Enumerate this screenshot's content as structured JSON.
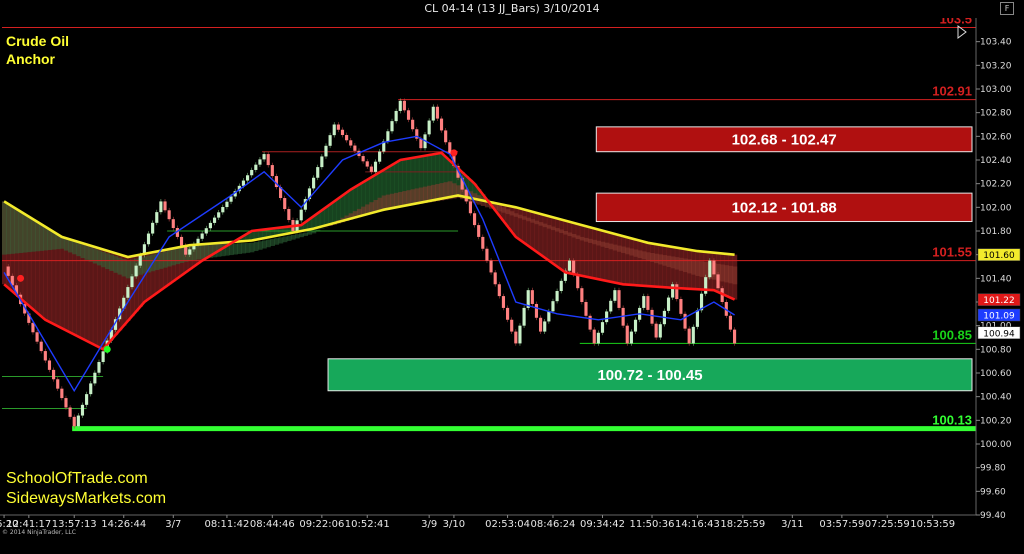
{
  "window": {
    "title": "CL 04-14 (13 JJ_Bars)  3/10/2014",
    "button_label": "F"
  },
  "branding": {
    "title_line1": "Crude Oil",
    "title_line2": "Anchor",
    "site1": "SchoolOfTrade.com",
    "site2": "SidewaysMarkets.com",
    "copyright": "© 2014 NinjaTrader, LLC"
  },
  "colors": {
    "background": "#000000",
    "up_bar": "#c8f0c8",
    "down_bar": "#ff8080",
    "fast_ma": "#1e3cff",
    "slow_ma": "#ff1a1a",
    "long_ma": "#f2ea2c",
    "resistance": "#d42020",
    "support": "#19d219",
    "bright_support": "#33ff33"
  },
  "chart_data": {
    "type": "renko_bars_with_moving_averages",
    "ylim": [
      99.4,
      103.6
    ],
    "y_ticks": [
      99.4,
      99.6,
      99.8,
      100.0,
      100.2,
      100.4,
      100.6,
      100.8,
      101.0,
      101.2,
      101.4,
      101.6,
      101.8,
      102.0,
      102.2,
      102.4,
      102.6,
      102.8,
      103.0,
      103.2,
      103.4
    ],
    "y_tick_labels": [
      "99.40",
      "99.60",
      "99.80",
      "100.00",
      "100.20",
      "100.40",
      "100.60",
      "100.80",
      "101.00",
      "101.20",
      "101.40",
      "101.60",
      "101.80",
      "102.00",
      "102.20",
      "102.40",
      "102.60",
      "102.80",
      "103.00",
      "103.20",
      "103.40"
    ],
    "x_ticks": [
      {
        "label": "46:20",
        "i": 0
      },
      {
        "label": "12:41:17",
        "i": 6
      },
      {
        "label": "13:57:13",
        "i": 17
      },
      {
        "label": "14:26:44",
        "i": 29
      },
      {
        "label": "3/7",
        "i": 41
      },
      {
        "label": "08:11:42",
        "i": 54
      },
      {
        "label": "08:44:46",
        "i": 65
      },
      {
        "label": "09:22:06",
        "i": 77
      },
      {
        "label": "10:52:41",
        "i": 88
      },
      {
        "label": "3/9",
        "i": 103
      },
      {
        "label": "3/10",
        "i": 109
      },
      {
        "label": "02:53:04",
        "i": 122
      },
      {
        "label": "08:46:24",
        "i": 133
      },
      {
        "label": "09:34:42",
        "i": 145
      },
      {
        "label": "11:50:36",
        "i": 157
      },
      {
        "label": "14:16:43",
        "i": 168
      },
      {
        "label": "18:25:59",
        "i": 179
      },
      {
        "label": "3/11",
        "i": 191
      },
      {
        "label": "03:57:59",
        "i": 203
      },
      {
        "label": "07:25:59",
        "i": 214
      },
      {
        "label": "10:53:59",
        "i": 225
      }
    ],
    "bars_pivots": [
      {
        "i": 0,
        "p": 101.5
      },
      {
        "i": 17,
        "p": 100.15
      },
      {
        "i": 38,
        "p": 102.05
      },
      {
        "i": 44,
        "p": 101.6
      },
      {
        "i": 63,
        "p": 102.45
      },
      {
        "i": 70,
        "p": 101.8
      },
      {
        "i": 80,
        "p": 102.7
      },
      {
        "i": 89,
        "p": 102.3
      },
      {
        "i": 96,
        "p": 102.9
      },
      {
        "i": 101,
        "p": 102.5
      },
      {
        "i": 104,
        "p": 102.85
      },
      {
        "i": 124,
        "p": 100.85
      },
      {
        "i": 127,
        "p": 101.3
      },
      {
        "i": 130,
        "p": 100.95
      },
      {
        "i": 137,
        "p": 101.55
      },
      {
        "i": 143,
        "p": 100.85
      },
      {
        "i": 148,
        "p": 101.3
      },
      {
        "i": 151,
        "p": 100.85
      },
      {
        "i": 155,
        "p": 101.25
      },
      {
        "i": 158,
        "p": 100.9
      },
      {
        "i": 162,
        "p": 101.35
      },
      {
        "i": 166,
        "p": 100.85
      },
      {
        "i": 171,
        "p": 101.55
      },
      {
        "i": 177,
        "p": 100.85
      }
    ],
    "bar_count": 178,
    "x_slots": 236,
    "fast_ma": [
      [
        0,
        101.45
      ],
      [
        17,
        100.45
      ],
      [
        30,
        101.2
      ],
      [
        40,
        101.75
      ],
      [
        55,
        102.1
      ],
      [
        63,
        102.3
      ],
      [
        72,
        102.0
      ],
      [
        82,
        102.4
      ],
      [
        92,
        102.55
      ],
      [
        100,
        102.6
      ],
      [
        108,
        102.45
      ],
      [
        116,
        101.9
      ],
      [
        124,
        101.2
      ],
      [
        134,
        101.1
      ],
      [
        144,
        101.05
      ],
      [
        154,
        101.1
      ],
      [
        164,
        101.05
      ],
      [
        172,
        101.2
      ],
      [
        177,
        101.09
      ]
    ],
    "slow_ma": [
      [
        0,
        101.35
      ],
      [
        10,
        101.05
      ],
      [
        24,
        100.8
      ],
      [
        34,
        101.2
      ],
      [
        48,
        101.55
      ],
      [
        60,
        101.8
      ],
      [
        72,
        101.85
      ],
      [
        84,
        102.15
      ],
      [
        96,
        102.4
      ],
      [
        106,
        102.46
      ],
      [
        114,
        102.2
      ],
      [
        124,
        101.75
      ],
      [
        136,
        101.45
      ],
      [
        150,
        101.35
      ],
      [
        162,
        101.32
      ],
      [
        172,
        101.3
      ],
      [
        177,
        101.22
      ]
    ],
    "long_ma": [
      [
        0,
        102.05
      ],
      [
        14,
        101.75
      ],
      [
        30,
        101.58
      ],
      [
        45,
        101.68
      ],
      [
        60,
        101.72
      ],
      [
        75,
        101.82
      ],
      [
        92,
        101.98
      ],
      [
        110,
        102.1
      ],
      [
        124,
        102.0
      ],
      [
        140,
        101.85
      ],
      [
        156,
        101.7
      ],
      [
        168,
        101.63
      ],
      [
        177,
        101.6
      ]
    ],
    "cloud_upper": [
      [
        0,
        101.6
      ],
      [
        14,
        101.65
      ],
      [
        30,
        101.4
      ],
      [
        45,
        101.55
      ],
      [
        60,
        101.62
      ],
      [
        75,
        101.78
      ],
      [
        92,
        102.1
      ],
      [
        108,
        102.22
      ],
      [
        124,
        101.95
      ],
      [
        140,
        101.75
      ],
      [
        156,
        101.62
      ],
      [
        168,
        101.55
      ],
      [
        177,
        101.5
      ]
    ],
    "cloud_lower": [
      [
        0,
        102.05
      ],
      [
        14,
        101.75
      ],
      [
        30,
        101.55
      ],
      [
        45,
        101.68
      ],
      [
        60,
        101.7
      ],
      [
        75,
        101.8
      ],
      [
        92,
        101.98
      ],
      [
        110,
        102.08
      ],
      [
        124,
        101.92
      ],
      [
        140,
        101.72
      ],
      [
        156,
        101.55
      ],
      [
        168,
        101.42
      ],
      [
        177,
        101.35
      ]
    ],
    "horizontal_levels": [
      {
        "price": 103.52,
        "label": "103.5",
        "color": "#d42020",
        "from_i": 0,
        "thickness": 1
      },
      {
        "price": 102.91,
        "label": "102.91",
        "color": "#d42020",
        "from_i": 96,
        "thickness": 1
      },
      {
        "price": 102.47,
        "label": "",
        "color": "#aa2020",
        "from_i": 63,
        "to_i": 110,
        "thickness": 1
      },
      {
        "price": 101.55,
        "label": "101.55",
        "color": "#d42020",
        "from_i": 0,
        "thickness": 1
      },
      {
        "price": 101.8,
        "label": "",
        "color": "#2a9a2a",
        "from_i": 40,
        "to_i": 110,
        "thickness": 1
      },
      {
        "price": 102.3,
        "label": "",
        "color": "#7a2020",
        "from_i": 88,
        "to_i": 110,
        "thickness": 1
      },
      {
        "price": 100.85,
        "label": "100.85",
        "color": "#19d219",
        "from_i": 140,
        "thickness": 1
      },
      {
        "price": 100.57,
        "label": "",
        "color": "#2a9a2a",
        "from_i": 0,
        "to_i": 24,
        "thickness": 1
      },
      {
        "price": 100.3,
        "label": "",
        "color": "#2a9a2a",
        "from_i": 0,
        "to_i": 20,
        "thickness": 1
      },
      {
        "price": 100.13,
        "label": "100.13",
        "color": "#33ff33",
        "from_i": 17,
        "thickness": 5
      }
    ],
    "zones": [
      {
        "label": "102.68 - 102.47",
        "top": 102.68,
        "bottom": 102.47,
        "from_i": 144,
        "to_i": 236,
        "color": "#b01010"
      },
      {
        "label": "102.12 - 101.88",
        "top": 102.12,
        "bottom": 101.88,
        "from_i": 144,
        "to_i": 236,
        "color": "#b01010"
      },
      {
        "label": "100.72 - 100.45",
        "top": 100.72,
        "bottom": 100.45,
        "from_i": 79,
        "to_i": 236,
        "color": "#17a85a"
      }
    ],
    "price_boxes": [
      {
        "label": "101.60",
        "price": 101.6,
        "bg": "#f2ea2c",
        "fg": "#000"
      },
      {
        "label": "101.22",
        "price": 101.22,
        "bg": "#e01818",
        "fg": "#fff"
      },
      {
        "label": "101.09",
        "price": 101.09,
        "bg": "#1e3cff",
        "fg": "#fff"
      },
      {
        "label": "100.94",
        "price": 100.94,
        "bg": "#ffffff",
        "fg": "#000"
      }
    ],
    "dots": [
      {
        "i": 4,
        "price": 101.4,
        "color": "#ff2020"
      },
      {
        "i": 25,
        "price": 100.8,
        "color": "#22ff22"
      },
      {
        "i": 109,
        "price": 102.46,
        "color": "#ff2020"
      }
    ]
  }
}
